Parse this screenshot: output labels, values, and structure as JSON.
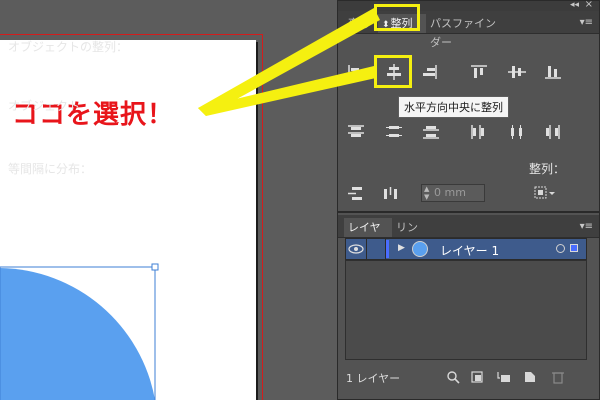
{
  "annotation": "ココを選択！",
  "align_panel": {
    "tabs": [
      {
        "label": "変形",
        "active": false
      },
      {
        "label": "整列",
        "active": true
      },
      {
        "label": "パスファインダー",
        "active": false
      }
    ],
    "section_align_objects": "オブジェクトの整列：",
    "section_distribute_objects": "オブジェクト",
    "section_distribute_spacing": "等間隔に分布：",
    "section_align_to": "整列：",
    "spacing_value": "0 mm",
    "tooltip": "水平方向中央に整列"
  },
  "layers_panel": {
    "tabs": [
      {
        "label": "レイヤー",
        "active": true
      },
      {
        "label": "リンク",
        "active": false
      }
    ],
    "layers": [
      {
        "name": "レイヤー 1",
        "color": "#4a6dff"
      }
    ],
    "footer_count": "1 レイヤー"
  },
  "colors": {
    "highlight": "#f5f010",
    "annotation": "#e8151b",
    "shape_fill": "#5aa0ef",
    "layer_color": "#4a6dff"
  }
}
